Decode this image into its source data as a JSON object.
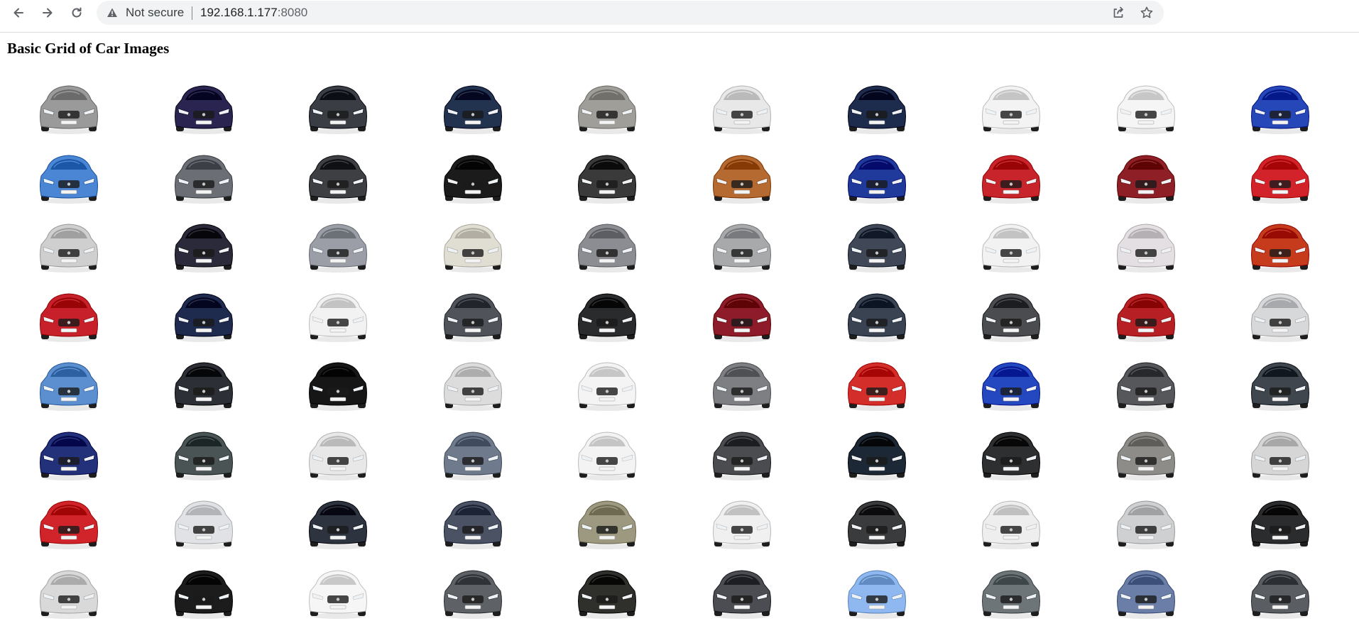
{
  "browser": {
    "security_label": "Not secure",
    "url_host": "192.168.1.177",
    "url_port": ":8080"
  },
  "page": {
    "title": "Basic Grid of Car Images"
  },
  "car_grid": {
    "rows": [
      [
        "#9a9a9a",
        "#2a2550",
        "#3a3d44",
        "#22334f",
        "#a09e98",
        "#e8e8e8",
        "#1d2c4d",
        "#f3f3f3",
        "#f5f5f5",
        "#2647b8"
      ],
      [
        "#4a86d4",
        "#6b6f75",
        "#3d3f43",
        "#1b1b1b",
        "#3a3a3a",
        "#b56a32",
        "#1f3a9a",
        "#c7252b",
        "#8e1f26",
        "#d3232a"
      ],
      [
        "#cfcfcf",
        "#2b2a3a",
        "#9b9ea6",
        "#e0ddd2",
        "#8b8d92",
        "#a7a9ab",
        "#404857",
        "#f2f2f2",
        "#e4dfe2",
        "#c53b1c"
      ],
      [
        "#c8202b",
        "#1f2a4f",
        "#f2f2f2",
        "#50545a",
        "#2a2b2d",
        "#8d1b2a",
        "#3a4352",
        "#4a4c50",
        "#b62025",
        "#d7d8da"
      ],
      [
        "#5b8fd0",
        "#2d2f36",
        "#161616",
        "#dcdcdc",
        "#f4f4f4",
        "#7d7f83",
        "#d42e2b",
        "#2448c0",
        "#55575a",
        "#3f464d"
      ],
      [
        "#23317a",
        "#4b5455",
        "#e8e8e8",
        "#6f7b8c",
        "#f3f3f3",
        "#4b4c4f",
        "#1d2836",
        "#2e2f31",
        "#8d8c88",
        "#d6d6d6"
      ],
      [
        "#d0242a",
        "#e0e2e6",
        "#2d3440",
        "#4a5264",
        "#9c9980",
        "#f0f0f0",
        "#3a3b3d",
        "#eeeeee",
        "#cfd0d2",
        "#2b2c2e"
      ],
      [
        "#d9d9d9",
        "#1c1c1c",
        "#f6f6f6",
        "#5e6266",
        "#2f2f2c",
        "#4b4d52",
        "#8fb8f0",
        "#6e7579",
        "#6b7ea8",
        "#5a5e63"
      ]
    ]
  }
}
